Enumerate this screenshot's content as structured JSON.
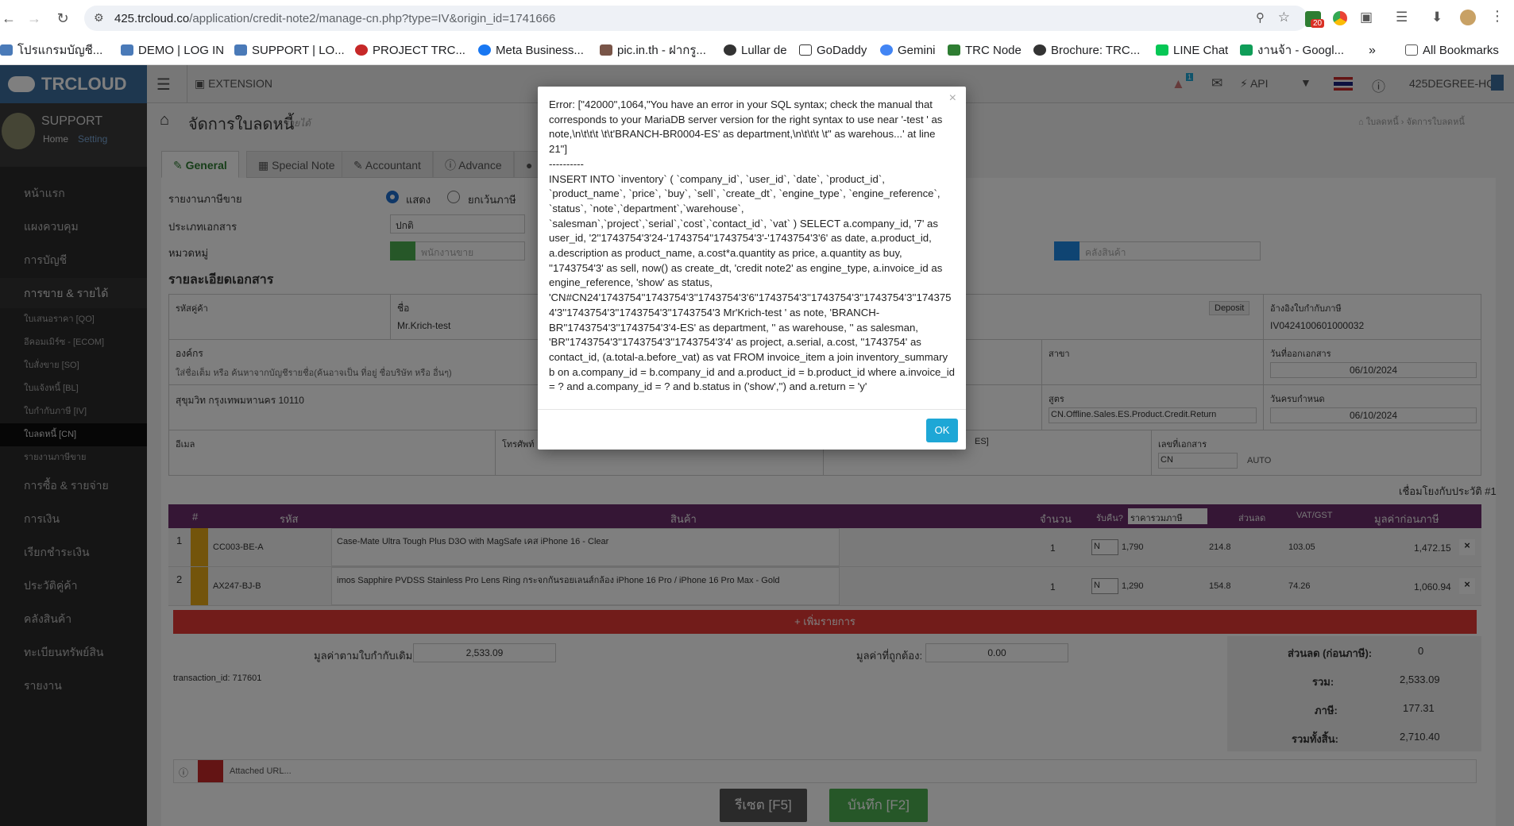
{
  "browser": {
    "url_host": "425.trcloud.co",
    "url_path": "/application/credit-note2/manage-cn.php?type=IV&origin_id=1741666",
    "ext_badge": "20",
    "bookmarks": [
      "โปรแกรมบัญชี...",
      "DEMO | LOG IN",
      "SUPPORT | LO...",
      "PROJECT TRC...",
      "Meta Business...",
      "pic.in.th - ฝากรู...",
      "Lullar de",
      "GoDaddy",
      "Gemini",
      "TRC Node",
      "Brochure: TRC...",
      "LINE Chat",
      "งานจ้า - Googl..."
    ],
    "all_bookmarks": "All Bookmarks"
  },
  "app": {
    "logo": "TRCLOUD",
    "extension": "EXTENSION",
    "api": "API",
    "company": "425DEGREE-HQ",
    "notif_count": "1"
  },
  "sidebar": {
    "user": "SUPPORT",
    "home": "Home",
    "setting": "Setting",
    "items": [
      "หน้าแรก",
      "แผงควบคุม",
      "การบัญชี",
      "การขาย & รายได้"
    ],
    "sub_items": [
      "ใบเสนอราคา [QO]",
      "อีคอมเมิร์ซ - [ECOM]",
      "ใบสั่งขาย [SO]",
      "ใบแจ้งหนี้ [BL]",
      "ใบกำกับภาษี [IV]",
      "ใบลดหนี้ [CN]",
      "รายงานภาษีขาย"
    ],
    "items2": [
      "การซื้อ & รายจ่าย",
      "การเงิน",
      "เรียกชำระเงิน",
      "ประวัติคู่ค้า",
      "คลังสินค้า",
      "ทะเบียนทรัพย์สิน",
      "รายงาน"
    ]
  },
  "page": {
    "title": "จัดการใบลดหนี้",
    "subtitle": "รายได้",
    "breadcrumb1": "ใบลดหนี้",
    "breadcrumb2": "จัดการใบลดหนี้",
    "tabs": [
      "General",
      "Special Note",
      "Accountant",
      "Advance"
    ],
    "tax_report_label": "รายงานภาษีขาย",
    "show_label": "แสดง",
    "exempt_label": "ยกเว้นภาษี",
    "doc_type_label": "ประเภทเอกสาร",
    "doc_type_value": "ปกติ",
    "category_label": "หมวดหมู่",
    "salesperson_placeholder": "พนักงานขาย",
    "warehouse_placeholder": "คลังสินค้า",
    "details_title": "รายละเอียดเอกสาร",
    "customer_code_label": "รหัสคู่ค้า",
    "name_label": "ชื่อ",
    "name_value": "Mr.Krich-test",
    "deposit": "Deposit",
    "ref_invoice_label": "อ้างอิงใบกำกับภาษี",
    "ref_invoice_value": "IV0424100601000032",
    "org_label": "องค์กร",
    "org_hint": "ใส่ชื่อเต็ม หรือ ค้นหาจากบัญชีรายชื่อ(ค้นอาจเป็น ที่อยู่ ชื่อบริษัท หรือ อื่นๆ)",
    "branch_label": "สาขา",
    "doc_date_label": "วันที่ออกเอกสาร",
    "doc_date_value": "06/10/2024",
    "address_value": "สุขุมวิท กรุงเทพมหานคร 10110",
    "formula_label": "สูตร",
    "formula_value": "CN.Offline.Sales.ES.Product.Credit.Return",
    "due_date_label": "วันครบกำหนด",
    "due_date_value": "06/10/2024",
    "email_label": "อีเมล",
    "phone_label": "โทรศัพท์",
    "es_label": "ES]",
    "doc_no_label": "เลขที่เอกสาร",
    "doc_no_value": "CN",
    "auto_label": "AUTO",
    "history_link": "เชื่อมโยงกับประวัติ #1"
  },
  "table": {
    "headers": [
      "#",
      "รหัส",
      "สินค้า",
      "จำนวน",
      "รับคืน?",
      "ราคารวมภาษี",
      "ส่วนลด",
      "VAT/GST",
      "มูลค่าก่อนภาษี"
    ],
    "rows": [
      {
        "no": "1",
        "code": "CC003-BE-A",
        "desc": "Case-Mate Ultra Tough Plus D3O with MagSafe เคส iPhone 16 - Clear",
        "qty": "1",
        "ret": "N",
        "price": "1,790",
        "disc": "214.8",
        "vat": "103.05",
        "amount": "1,472.15"
      },
      {
        "no": "2",
        "code": "AX247-BJ-B",
        "desc": "imos Sapphire PVDSS Stainless Pro Lens Ring กระจกกันรอยเลนส์กล้อง iPhone 16 Pro / iPhone 16 Pro Max - Gold",
        "qty": "1",
        "ret": "N",
        "price": "1,290",
        "disc": "154.8",
        "vat": "74.26",
        "amount": "1,060.94"
      }
    ],
    "add_row": "+ เพิ่มรายการ"
  },
  "totals": {
    "orig_label": "มูลค่าตามใบกำกับเดิม:",
    "orig_value": "2,533.09",
    "correct_label": "มูลค่าที่ถูกต้อง:",
    "correct_value": "0.00",
    "transaction": "transaction_id: 717601",
    "discount_label": "ส่วนลด (ก่อนภาษี):",
    "discount_value": "0",
    "sum_label": "รวม:",
    "sum_value": "2,533.09",
    "tax_label": "ภาษี:",
    "tax_value": "177.31",
    "grand_label": "รวมทั้งสิ้น:",
    "grand_value": "2,710.40",
    "attached": "Attached URL...",
    "reset_btn": "รีเซต [F5]",
    "save_btn": "บันทึก [F2]"
  },
  "modal": {
    "message": "Error: [\"42000\",1064,\"You have an error in your SQL syntax; check the manual that corresponds to your MariaDB server version for the right syntax to use near '-test ' as note,\\n\\t\\t\\t \\t\\t'BRANCH-BR0004-ES' as department,\\n\\t\\t\\t \\t\" as warehous...' at line 21\"]\n----------\nINSERT INTO `inventory` ( `company_id`, `user_id`, `date`, `product_id`, `product_name`, `price`, `buy`, `sell`, `create_dt`, `engine_type`, `engine_reference`, `status`, `note`,`department`,`warehouse`, `salesman`,`project`,`serial`,`cost`,`contact_id`, `vat` ) SELECT a.company_id, '7' as user_id, '2''1743754'3'24-'1743754''1743754'3'-'1743754'3'6' as date, a.product_id, a.description as product_name, a.cost*a.quantity as price, a.quantity as buy, ''1743754'3' as sell, now() as create_dt, 'credit note2' as engine_type, a.invoice_id as engine_reference, 'show' as status, 'CN#CN24'1743754''1743754'3''1743754'3'6''1743754'3''1743754'3''1743754'3''1743754'3''1743754'3''1743754'3''1743754'3 Mr'Krich-test ' as note, 'BRANCH-BR''1743754'3''1743754'3'4-ES' as department, '' as warehouse, '' as salesman, 'BR''1743754'3''1743754'3''1743754'3'4' as project, a.serial, a.cost, ''1743754' as contact_id, (a.total-a.before_vat) as vat FROM invoice_item a join inventory_summary b on a.company_id = b.company_id and a.product_id = b.product_id where a.invoice_id = ? and a.company_id = ? and b.status in ('show','') and a.return = 'y'",
    "close": "×",
    "ok": "OK"
  }
}
